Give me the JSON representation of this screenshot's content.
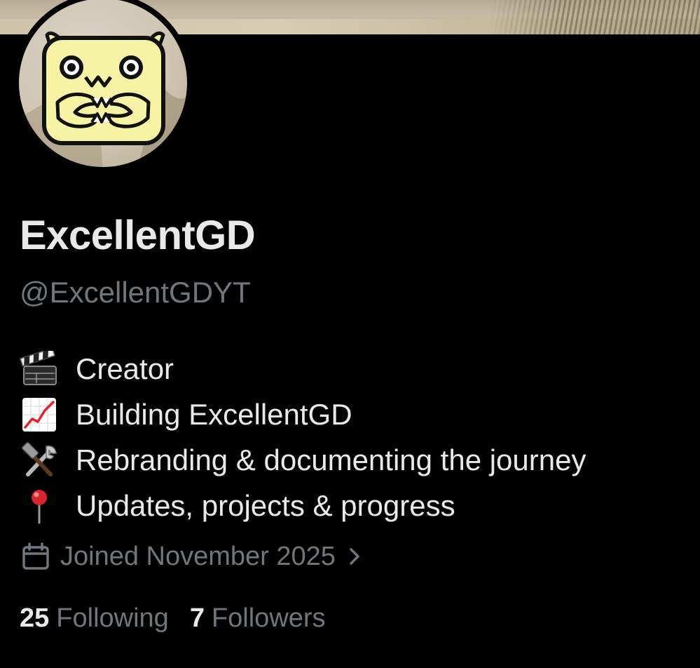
{
  "profile": {
    "display_name": "ExcellentGD",
    "handle": "@ExcellentGDYT"
  },
  "bio": [
    {
      "icon": "clapperboard-icon",
      "text": "Creator"
    },
    {
      "icon": "chart-increasing-icon",
      "text": "Building ExcellentGD"
    },
    {
      "icon": "hammer-wrench-icon",
      "text": "Rebranding & documenting the journey"
    },
    {
      "icon": "round-pushpin-icon",
      "text": "Updates, projects & progress"
    }
  ],
  "joined": {
    "icon": "calendar-icon",
    "text": "Joined November 2025"
  },
  "stats": {
    "following_count": "25",
    "following_label": "Following",
    "followers_count": "7",
    "followers_label": "Followers"
  },
  "colors": {
    "background": "#000000",
    "primary_text": "#e7e9ea",
    "secondary_text": "#71767b",
    "avatar_fill": "#f7f3a4"
  }
}
